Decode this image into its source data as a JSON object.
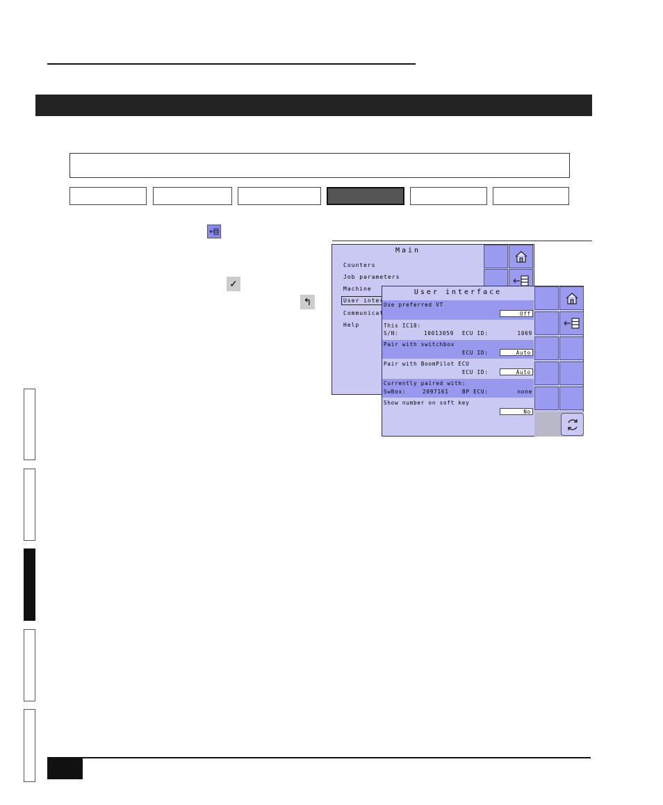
{
  "page": {
    "tabs": [
      {
        "label": ""
      },
      {
        "label": ""
      },
      {
        "label": ""
      },
      {
        "label": ""
      },
      {
        "label": ""
      },
      {
        "label": ""
      }
    ],
    "inline_icons": {
      "menu_icon": "menu-list-icon",
      "accept_icon": "checkmark-icon",
      "return_icon": "return-arrow-icon"
    }
  },
  "main_screen": {
    "title": "Main",
    "items": [
      "Counters",
      "Job parameters",
      "Machine",
      "User interf",
      "Communicati",
      "Help"
    ],
    "selected_index": 3
  },
  "ui_screen": {
    "title": "User interface",
    "use_preferred_vt_label": "Use preferred VT",
    "use_preferred_vt_value": "Off",
    "this_ic18_label": "This IC18:",
    "sn_label": "S/N:",
    "sn_value": "10013059",
    "ecu_id_label": "ECU ID:",
    "ecu_id_value": "1069",
    "pair_switchbox_label": "Pair with switchbox",
    "pair_switchbox_ecu_label": "ECU ID:",
    "pair_switchbox_ecu_value": "Auto",
    "pair_boompilot_label": "Pair with BoomPilot ECU",
    "pair_boompilot_ecu_label": "ECU ID:",
    "pair_boompilot_ecu_value": "Auto",
    "currently_paired_label": "Currently paired with:",
    "swbox_label": "SwBox:",
    "swbox_value": "2097161",
    "bp_ecu_label": "BP ECU:",
    "bp_ecu_value": "none",
    "show_number_label": "Show number on soft key",
    "show_number_value": "No"
  },
  "colors": {
    "screen_bg": "#c9c9f4",
    "highlight": "#9898ee",
    "softkey": "#9a9af0"
  }
}
